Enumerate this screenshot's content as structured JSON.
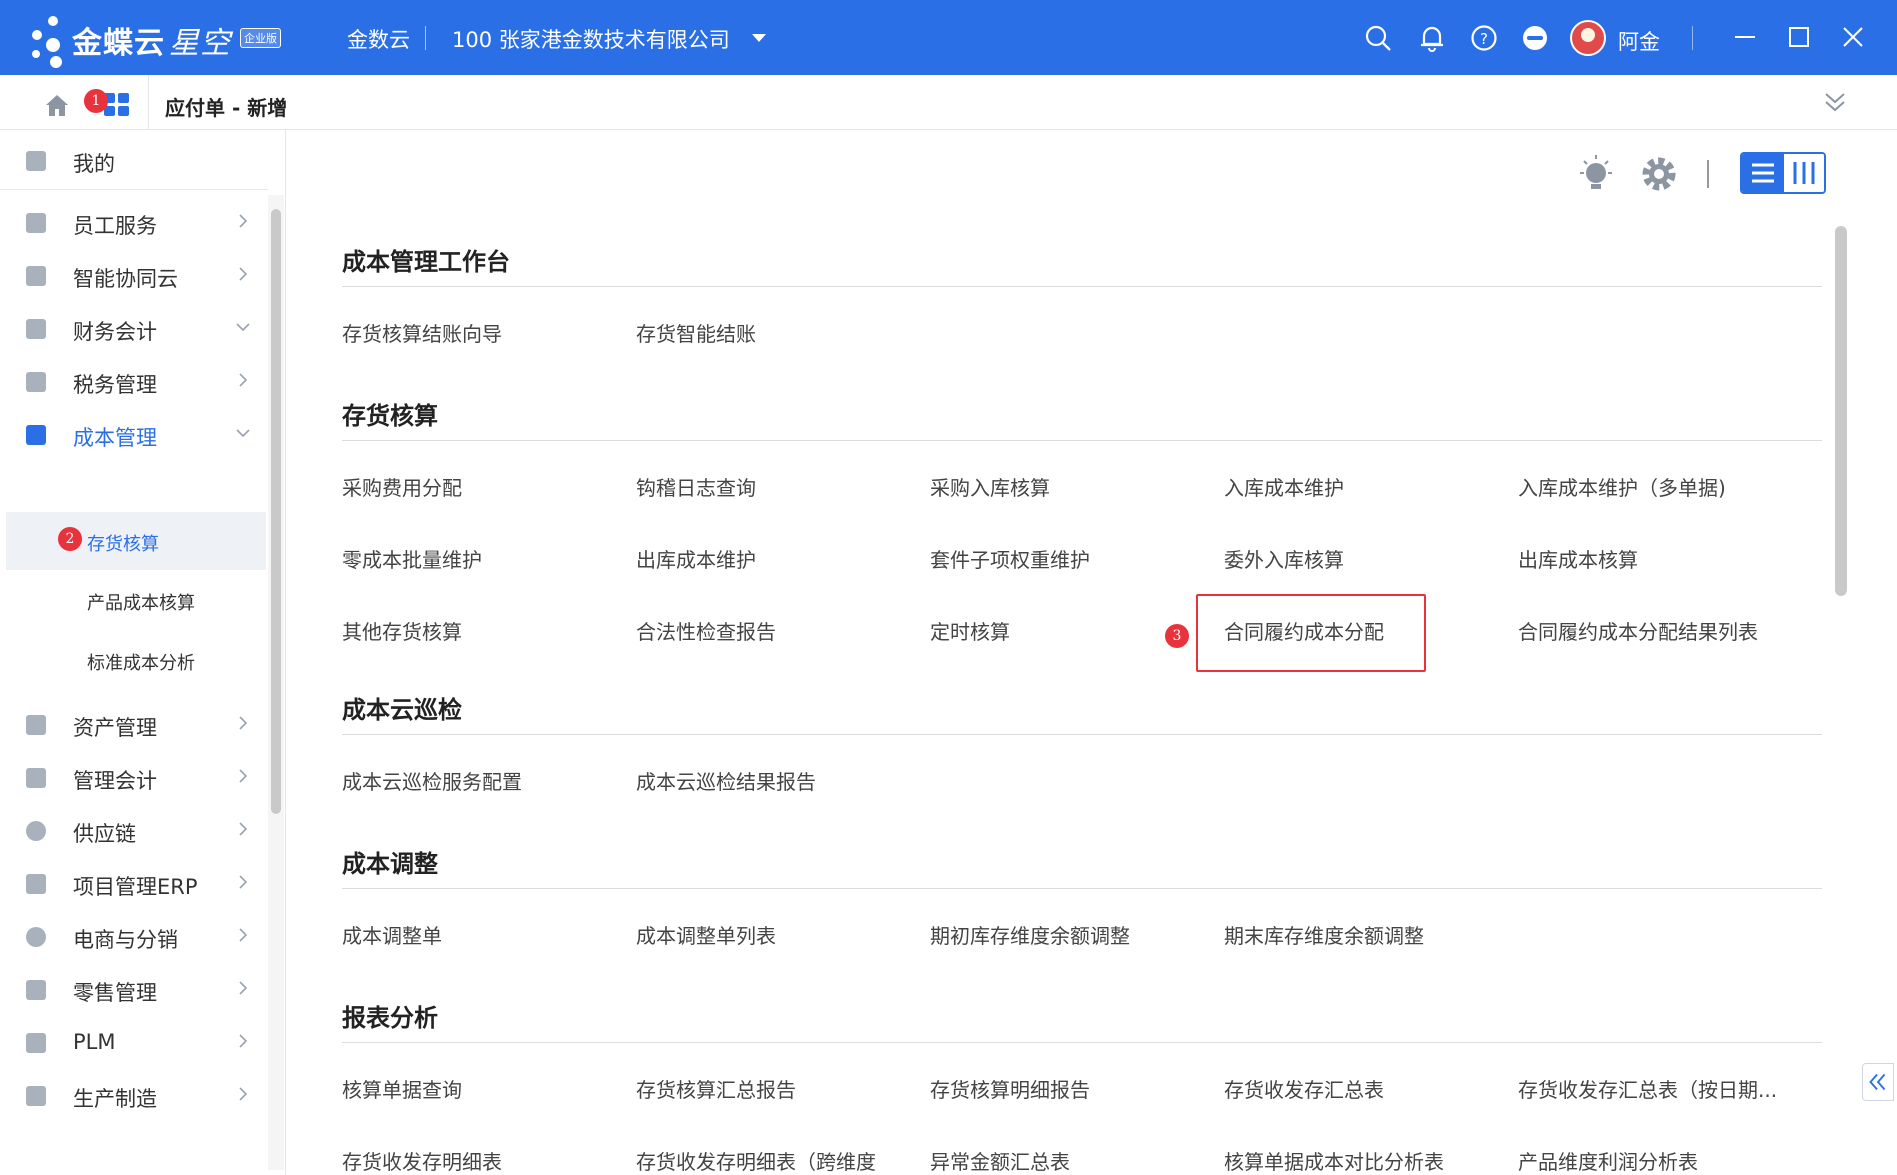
{
  "topbar": {
    "brand": "金蝶云",
    "product": "星空",
    "edition": "企业版",
    "cloud_link": "金数云",
    "org": "100  张家港金数技术有限公司",
    "user": "阿金",
    "icons": [
      "search-icon",
      "bell-icon",
      "help-icon",
      "more-icon",
      "minimize-icon",
      "maximize-icon",
      "close-icon"
    ]
  },
  "tabbar": {
    "title": "应付单 - 新增",
    "badge1": "1"
  },
  "sidebar": {
    "items": [
      {
        "label": "我的"
      },
      {
        "label": "员工服务"
      },
      {
        "label": "智能协同云"
      },
      {
        "label": "财务会计"
      },
      {
        "label": "税务管理"
      },
      {
        "label": "成本管理"
      },
      {
        "label": "资产管理"
      },
      {
        "label": "管理会计"
      },
      {
        "label": "供应链"
      },
      {
        "label": "项目管理ERP"
      },
      {
        "label": "电商与分销"
      },
      {
        "label": "零售管理"
      },
      {
        "label": "PLM"
      },
      {
        "label": "生产制造"
      }
    ],
    "sub_items": [
      {
        "label": "存货核算",
        "badge": "2"
      },
      {
        "label": "产品成本核算"
      },
      {
        "label": "标准成本分析"
      }
    ]
  },
  "main": {
    "sections": [
      {
        "title": "成本管理工作台",
        "items": [
          "存货核算结账向导",
          "存货智能结账"
        ]
      },
      {
        "title": "存货核算",
        "items": [
          "采购费用分配",
          "钩稽日志查询",
          "采购入库核算",
          "入库成本维护",
          "入库成本维护（多单据)",
          "零成本批量维护",
          "出库成本维护",
          "套件子项权重维护",
          "委外入库核算",
          "出库成本核算",
          "其他存货核算",
          "合法性检查报告",
          "定时核算",
          "合同履约成本分配",
          "合同履约成本分配结果列表"
        ]
      },
      {
        "title": "成本云巡检",
        "items": [
          "成本云巡检服务配置",
          "成本云巡检结果报告"
        ]
      },
      {
        "title": "成本调整",
        "items": [
          "成本调整单",
          "成本调整单列表",
          "期初库存维度余额调整",
          "期末库存维度余额调整"
        ]
      },
      {
        "title": "报表分析",
        "items": [
          "核算单据查询",
          "存货核算汇总报告",
          "存货核算明细报告",
          "存货收发存汇总表",
          "存货收发存汇总表（按日期...",
          "存货收发存明细表",
          "存货收发存明细表（跨维度",
          "异常金额汇总表",
          "核算单据成本对比分析表",
          "产品维度利润分析表"
        ]
      }
    ],
    "badge3": "3",
    "colors": {
      "accent": "#2a6fe6",
      "badge": "#e8323c"
    }
  }
}
